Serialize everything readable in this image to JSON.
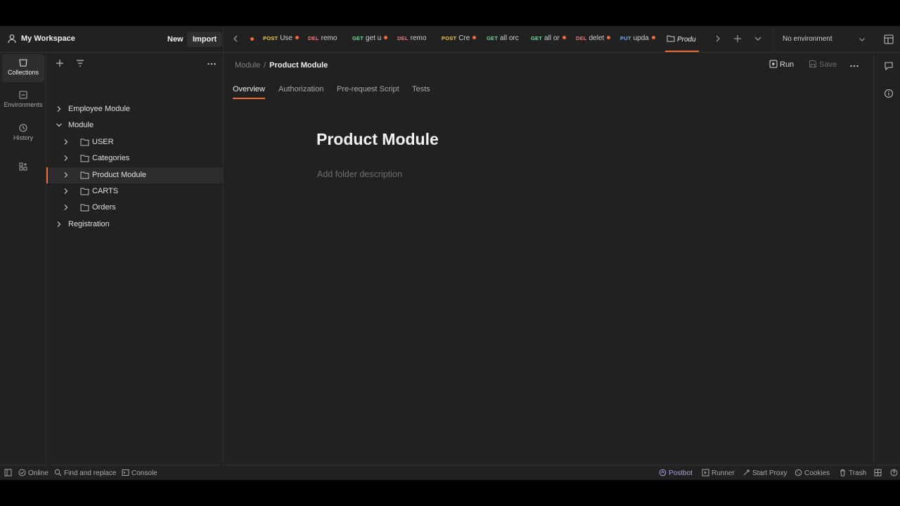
{
  "workspace": {
    "title": "My Workspace",
    "new_label": "New",
    "import_label": "Import"
  },
  "tabs": [
    {
      "method": "POST",
      "name": "Use",
      "unsaved": true
    },
    {
      "method": "DEL",
      "name": "remo",
      "unsaved": false
    },
    {
      "method": "GET",
      "name": "get u",
      "unsaved": true
    },
    {
      "method": "DEL",
      "name": "remo",
      "unsaved": false
    },
    {
      "method": "POST",
      "name": "Cre",
      "unsaved": true
    },
    {
      "method": "GET",
      "name": "all orc",
      "unsaved": false
    },
    {
      "method": "GET",
      "name": "all or",
      "unsaved": true
    },
    {
      "method": "DEL",
      "name": "delet",
      "unsaved": true
    },
    {
      "method": "PUT",
      "name": "upda",
      "unsaved": true
    },
    {
      "method": "",
      "name": "Produ",
      "active": true
    }
  ],
  "environment": {
    "selected": "No environment"
  },
  "rail": {
    "collections": "Collections",
    "environments": "Environments",
    "history": "History"
  },
  "tree": {
    "employee": "Employee Module",
    "module": "Module",
    "user": "USER",
    "categories": "Categories",
    "product": "Product Module",
    "carts": "CARTS",
    "orders": "Orders",
    "registration": "Registration"
  },
  "breadcrumb": {
    "parent": "Module",
    "separator": "/",
    "current": "Product Module"
  },
  "actions": {
    "run": "Run",
    "save": "Save"
  },
  "subtabs": [
    "Overview",
    "Authorization",
    "Pre-request Script",
    "Tests"
  ],
  "page": {
    "title": "Product Module",
    "description_placeholder": "Add folder description"
  },
  "statusbar": {
    "online": "Online",
    "find": "Find and replace",
    "console": "Console",
    "postbot": "Postbot",
    "runner": "Runner",
    "proxy": "Start Proxy",
    "cookies": "Cookies",
    "trash": "Trash"
  },
  "colors": {
    "accent": "#f26b3a",
    "post": "#f2c744",
    "del": "#f27575",
    "get": "#6bdd9a",
    "put": "#74aef6"
  }
}
